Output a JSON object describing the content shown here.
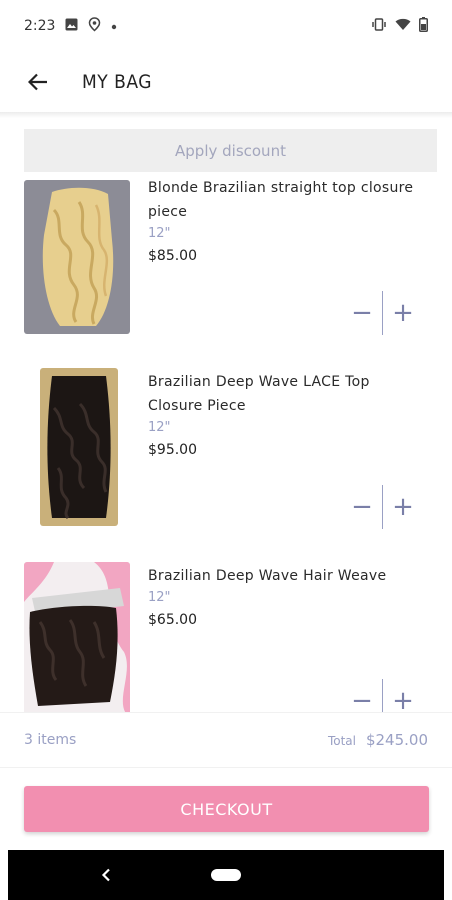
{
  "status_bar": {
    "time": "2:23",
    "icons": [
      "image-icon",
      "location-icon",
      "dot-icon",
      "vibrate-icon",
      "wifi-icon",
      "battery-icon"
    ]
  },
  "app_bar": {
    "title": "MY BAG",
    "back_icon": "arrow-left-icon"
  },
  "discount": {
    "label": "Apply discount"
  },
  "items": [
    {
      "name": "Blonde Brazilian straight  top closure piece",
      "variant": "12\"",
      "price": "$85.00",
      "image": "blonde-hair-closure"
    },
    {
      "name": "Brazilian Deep Wave LACE Top Closure Piece",
      "variant": "12\"",
      "price": "$95.00",
      "image": "deep-wave-closure"
    },
    {
      "name": "Brazilian Deep Wave Hair Weave",
      "variant": "12\"",
      "price": "$65.00",
      "image": "deep-wave-weave"
    }
  ],
  "quantity_controls": {
    "minus": "−",
    "plus": "+"
  },
  "summary": {
    "count": "3 items",
    "total_label": "Total",
    "total_value": "$245.00"
  },
  "checkout": {
    "label": "CHECKOUT"
  },
  "colors": {
    "accent_pink": "#f28fb0",
    "muted_lavender": "#9aa0c4"
  }
}
